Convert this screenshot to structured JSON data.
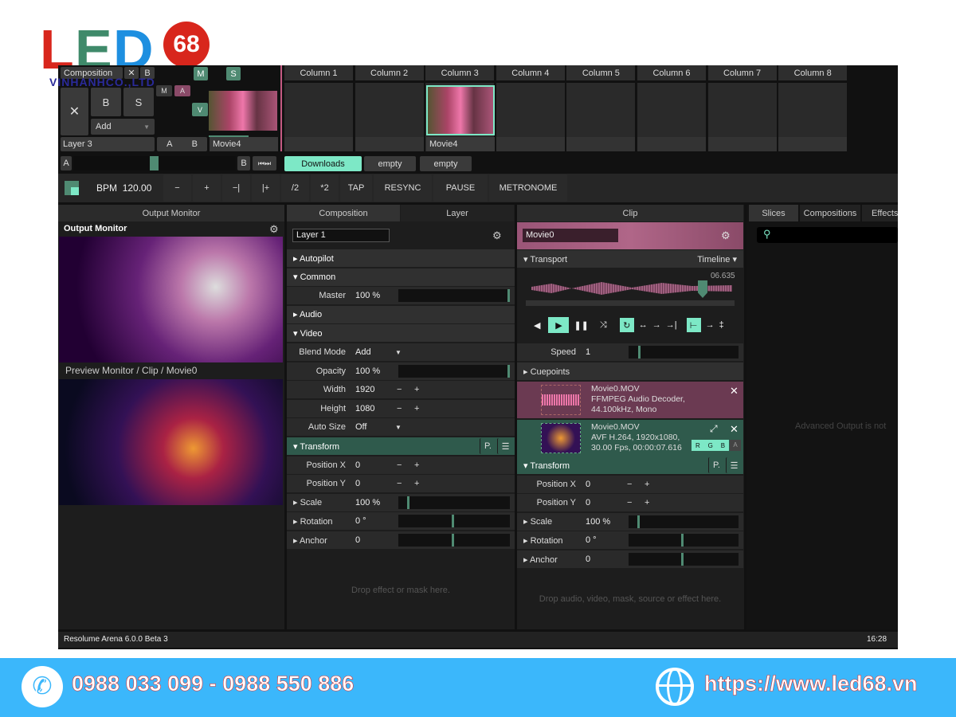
{
  "logo": {
    "text": "LED",
    "num": "68",
    "sub": "VINHANHCO.,LTD"
  },
  "colors": {
    "accent": "#7de8c6",
    "green": "#4f8a72",
    "pink": "#8a4a68",
    "footer": "#3bb7fb"
  },
  "layer": {
    "composition": "Composition",
    "x": "✕",
    "b": "B",
    "m": "M",
    "s": "S",
    "big_x": "✕",
    "big_b": "B",
    "big_s": "S",
    "add": "Add",
    "m2": "M",
    "a2": "A",
    "v": "V",
    "name": "Layer 3",
    "ab_a": "A",
    "ab_b": "B",
    "clip1": "Movie4"
  },
  "columns": [
    "Column 1",
    "Column 2",
    "Column 3",
    "Column 4",
    "Column 5",
    "Column 6",
    "Column 7",
    "Column 8"
  ],
  "clip_col3": "Movie4",
  "crossfader": {
    "a": "A",
    "b": "B",
    "skip": "⏮⏭"
  },
  "decks": [
    "Downloads",
    "empty",
    "empty"
  ],
  "bpm": {
    "label": "BPM",
    "value": "120.00",
    "buttons": [
      "−",
      "+",
      "−|",
      "|+",
      "/2",
      "*2",
      "TAP",
      "RESYNC",
      "PAUSE",
      "METRONOME"
    ]
  },
  "output": {
    "header": "Output Monitor",
    "title": "Output Monitor",
    "preview": "Preview Monitor / Clip / Movie0"
  },
  "comp": {
    "tabs": [
      "Composition",
      "Layer"
    ],
    "name": "Layer 1",
    "drop": "Drop effect or mask here.",
    "rows": [
      [
        "sec",
        "Autopilot"
      ],
      [
        "sec",
        "Common",
        "open"
      ],
      [
        "p",
        "Master",
        "100 %",
        "slider",
        1
      ],
      [
        "sec",
        "Audio"
      ],
      [
        "sec",
        "Video",
        "open"
      ],
      [
        "d",
        "Blend Mode",
        "Add"
      ],
      [
        "p",
        "Opacity",
        "100 %",
        "slider",
        1
      ],
      [
        "n",
        "Width",
        "1920"
      ],
      [
        "n",
        "Height",
        "1080"
      ],
      [
        "d",
        "Auto Size",
        "Off"
      ],
      [
        "tr",
        "Transform"
      ],
      [
        "n",
        "Position X",
        "0"
      ],
      [
        "n",
        "Position Y",
        "0"
      ],
      [
        "ps",
        "Scale",
        "100 %",
        "slider",
        0.1
      ],
      [
        "ps",
        "Rotation",
        "0 °",
        "slider",
        0.5
      ],
      [
        "ps",
        "Anchor",
        "0",
        "slider",
        0.5
      ]
    ]
  },
  "clip": {
    "header": "Clip",
    "name": "Movie0",
    "transport": "Transport",
    "mode": "Timeline",
    "time": "06.635",
    "speed_label": "Speed",
    "speed": "1",
    "cuepoints": "Cuepoints",
    "audio": {
      "file": "Movie0.MOV",
      "l2": "FFMPEG Audio Decoder,",
      "l3": "44.100kHz, Mono"
    },
    "video": {
      "file": "Movie0.MOV",
      "l2": "AVF H.264, 1920x1080,",
      "l3": "30.00 Fps, 00:00:07.616",
      "r": "R",
      "g": "G",
      "b": "B",
      "a": "A"
    },
    "drop": "Drop audio, video, mask, source or effect here.",
    "rows": [
      [
        "tr",
        "Transform"
      ],
      [
        "n",
        "Position X",
        "0"
      ],
      [
        "n",
        "Position Y",
        "0"
      ],
      [
        "ps",
        "Scale",
        "100 %",
        "slider",
        0.1
      ],
      [
        "ps",
        "Rotation",
        "0 °",
        "slider",
        0.5
      ],
      [
        "ps",
        "Anchor",
        "0",
        "slider",
        0.5
      ]
    ]
  },
  "right": {
    "tabs": [
      "Slices",
      "Compositions",
      "Effects"
    ],
    "note": "Advanced Output is not"
  },
  "status": {
    "app": "Resolume Arena 6.0.0  Beta 3",
    "time": "16:28"
  },
  "footer": {
    "phone": "0988 033 099 - 0988 550 886",
    "url": "https://www.led68.vn"
  }
}
